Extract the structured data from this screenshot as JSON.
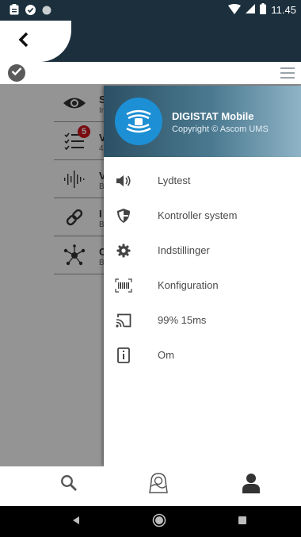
{
  "status_bar": {
    "time": "11.45"
  },
  "drawer": {
    "app_name": "DIGISTAT Mobile",
    "copyright": "Copyright © Ascom UMS",
    "menu": [
      {
        "label": "Lydtest",
        "icon": "speaker-icon"
      },
      {
        "label": "Kontroller system",
        "icon": "shield-icon"
      },
      {
        "label": "Indstillinger",
        "icon": "gear-icon"
      },
      {
        "label": "Konfiguration",
        "icon": "barcode-icon"
      },
      {
        "label": "99% 15ms",
        "icon": "cast-icon"
      },
      {
        "label": "Om",
        "icon": "info-icon"
      }
    ]
  },
  "list": {
    "rows": [
      {
        "title": "S",
        "subtitle": "In",
        "icon": "eye-icon"
      },
      {
        "title": "V",
        "subtitle": "4",
        "icon": "checklist-icon",
        "badge": "5"
      },
      {
        "title": "V",
        "subtitle": "B",
        "icon": "waveform-icon"
      },
      {
        "title": "I",
        "subtitle": "B",
        "icon": "link-icon"
      },
      {
        "title": "C",
        "subtitle": "B",
        "icon": "network-icon"
      }
    ]
  },
  "bottom_nav": [
    "search-icon",
    "patient-icon",
    "user-icon"
  ],
  "colors": {
    "header_bg": "#1b2f3c",
    "logo_blue": "#1d8fd5",
    "badge_red": "#d3141c"
  }
}
